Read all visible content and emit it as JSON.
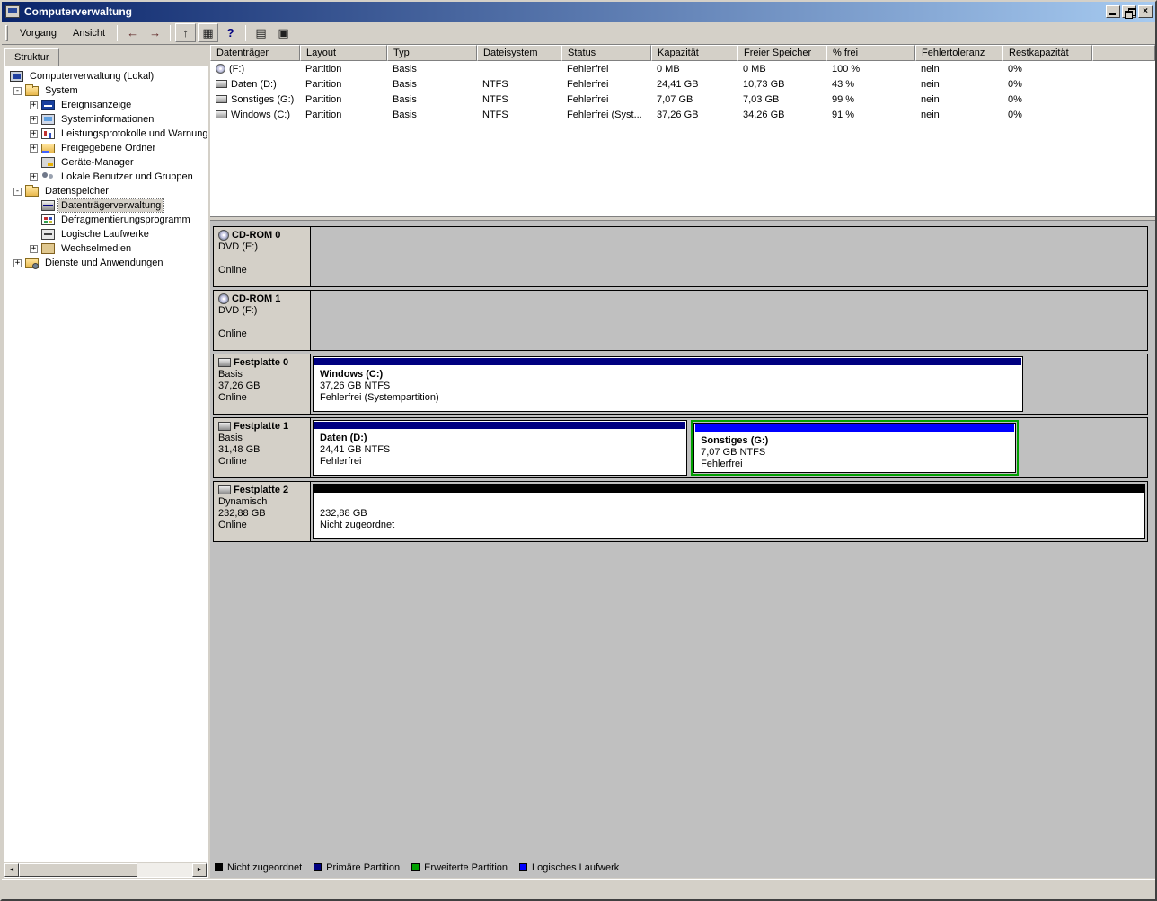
{
  "window": {
    "title": "Computerverwaltung",
    "close_glyph": "×"
  },
  "toolbar": {
    "menus": [
      "Vorgang",
      "Ansicht"
    ],
    "buttons": [
      {
        "name": "back",
        "glyph": "←"
      },
      {
        "name": "forward",
        "glyph": "→"
      },
      {
        "name": "up-level",
        "glyph": "↑"
      },
      {
        "name": "show-console-tree",
        "glyph": "▦"
      },
      {
        "name": "help",
        "glyph": "?"
      },
      {
        "name": "properties",
        "glyph": "▤"
      },
      {
        "name": "disk-view",
        "glyph": "▣"
      }
    ]
  },
  "sidebar": {
    "tab": "Struktur",
    "tree": [
      {
        "label": "Computerverwaltung (Lokal)",
        "expander": ""
      },
      {
        "label": "System",
        "expander": "-"
      },
      {
        "label": "Ereignisanzeige",
        "expander": "+"
      },
      {
        "label": "Systeminformationen",
        "expander": "+"
      },
      {
        "label": "Leistungsprotokolle und Warnung",
        "expander": "+"
      },
      {
        "label": "Freigegebene Ordner",
        "expander": "+"
      },
      {
        "label": "Geräte-Manager",
        "expander": ""
      },
      {
        "label": "Lokale Benutzer und Gruppen",
        "expander": "+"
      },
      {
        "label": "Datenspeicher",
        "expander": "-"
      },
      {
        "label": "Datenträgerverwaltung",
        "expander": ""
      },
      {
        "label": "Defragmentierungsprogramm",
        "expander": ""
      },
      {
        "label": "Logische Laufwerke",
        "expander": ""
      },
      {
        "label": "Wechselmedien",
        "expander": "+"
      },
      {
        "label": "Dienste und Anwendungen",
        "expander": "+"
      }
    ]
  },
  "volumes": {
    "columns": [
      "Datenträger",
      "Layout",
      "Typ",
      "Dateisystem",
      "Status",
      "Kapazität",
      "Freier Speicher",
      "% frei",
      "Fehlertoleranz",
      "Restkapazität"
    ],
    "rows": [
      [
        "(F:)",
        "Partition",
        "Basis",
        "",
        "Fehlerfrei",
        "0 MB",
        "0 MB",
        "100 %",
        "nein",
        "0%"
      ],
      [
        "Daten (D:)",
        "Partition",
        "Basis",
        "NTFS",
        "Fehlerfrei",
        "24,41 GB",
        "10,73 GB",
        "43 %",
        "nein",
        "0%"
      ],
      [
        "Sonstiges (G:)",
        "Partition",
        "Basis",
        "NTFS",
        "Fehlerfrei",
        "7,07 GB",
        "7,03 GB",
        "99 %",
        "nein",
        "0%"
      ],
      [
        "Windows (C:)",
        "Partition",
        "Basis",
        "NTFS",
        "Fehlerfrei (Syst...",
        "37,26 GB",
        "34,26 GB",
        "91 %",
        "nein",
        "0%"
      ]
    ]
  },
  "disks": [
    {
      "name": "CD-ROM 0",
      "line1": "DVD (E:)",
      "line2": "",
      "line3": "Online",
      "partitions": []
    },
    {
      "name": "CD-ROM 1",
      "line1": "DVD (F:)",
      "line2": "",
      "line3": "Online",
      "partitions": []
    },
    {
      "name": "Festplatte 0",
      "line1": "Basis",
      "line2": "37,26 GB",
      "line3": "Online",
      "partitions": [
        {
          "title": "Windows (C:)",
          "size": "37,26 GB NTFS",
          "status": "Fehlerfrei (Systempartition)",
          "kind": "primary"
        }
      ]
    },
    {
      "name": "Festplatte 1",
      "line1": "Basis",
      "line2": "31,48 GB",
      "line3": "Online",
      "partitions": [
        {
          "title": "Daten (D:)",
          "size": "24,41 GB NTFS",
          "status": "Fehlerfrei",
          "kind": "primary"
        },
        {
          "title": "Sonstiges (G:)",
          "size": "7,07 GB NTFS",
          "status": "Fehlerfrei",
          "kind": "logical"
        }
      ]
    },
    {
      "name": "Festplatte 2",
      "line1": "Dynamisch",
      "line2": "232,88 GB",
      "line3": "Online",
      "partitions": [
        {
          "title": "",
          "size": "232,88 GB",
          "status": "Nicht zugeordnet",
          "kind": "unallocated"
        }
      ]
    }
  ],
  "legend": [
    {
      "label": "Nicht zugeordnet",
      "color": "#000000"
    },
    {
      "label": "Primäre Partition",
      "color": "#000080"
    },
    {
      "label": "Erweiterte Partition",
      "color": "#00a000"
    },
    {
      "label": "Logisches Laufwerk",
      "color": "#0000ff"
    }
  ],
  "scrollbar": {
    "left_glyph": "◄",
    "right_glyph": "►"
  },
  "colors": {
    "titlebar_gradient_start": "#0a246a",
    "titlebar_gradient_end": "#a6caf0",
    "window_face": "#d4d0c8",
    "disk_area_background": "#c0c0c0",
    "primary_partition_bar": "#000080",
    "logical_drive_bar": "#0000ff",
    "unallocated_bar": "#000000",
    "extended_partition_border": "#00a000"
  }
}
